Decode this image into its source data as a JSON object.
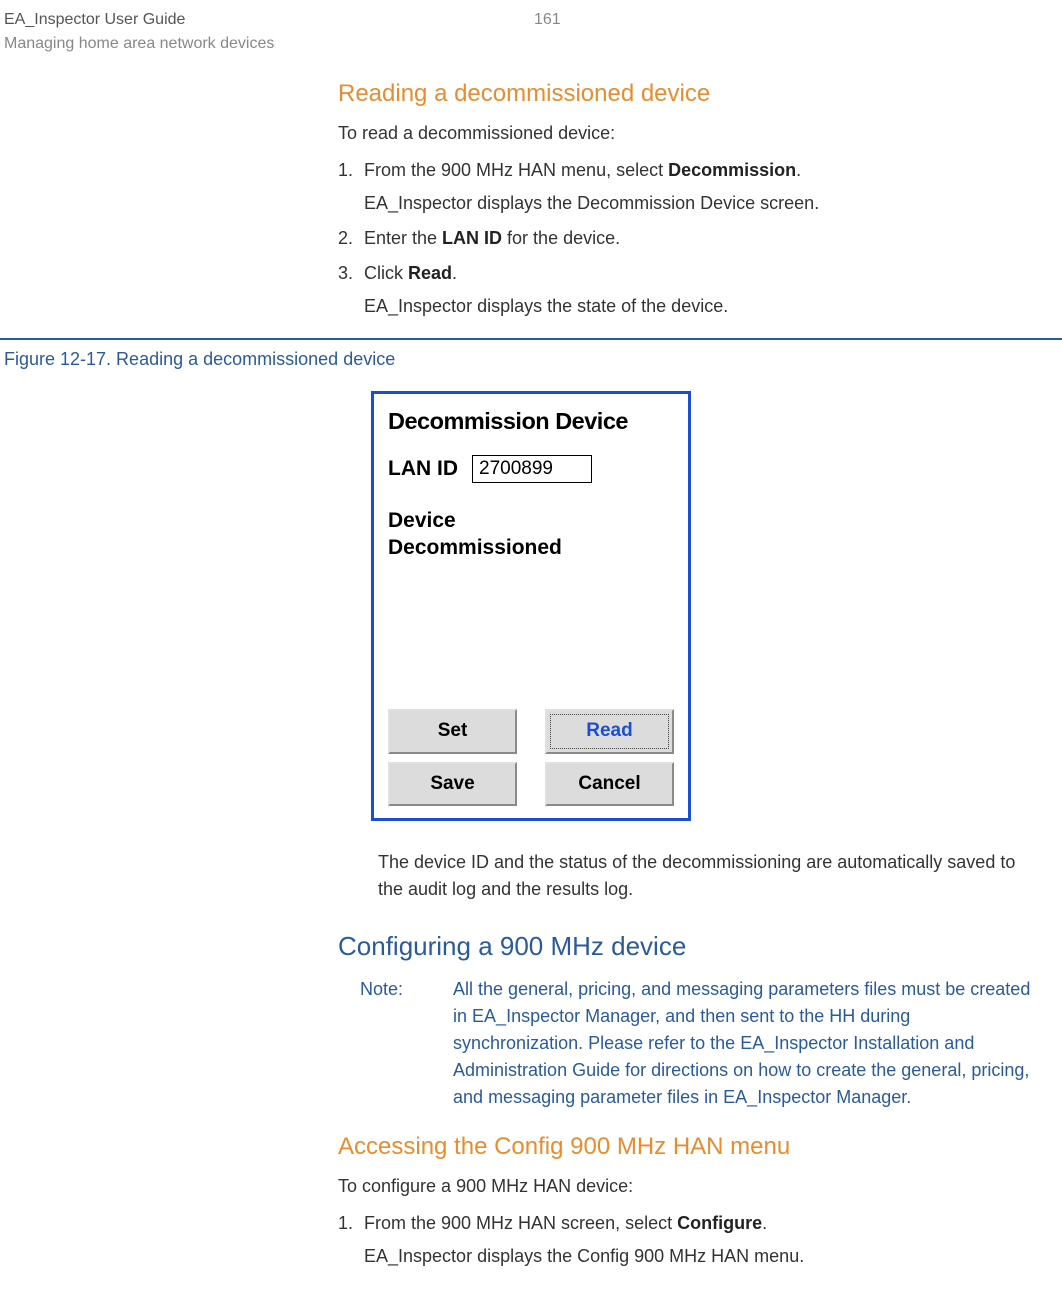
{
  "header": {
    "doc_title": "EA_Inspector User Guide",
    "doc_section": "Managing home area network devices",
    "page_number": "161"
  },
  "section1": {
    "heading": "Reading a decommissioned device",
    "intro": "To read a decommissioned device:",
    "steps": [
      {
        "text_before": "From the 900 MHz HAN menu, select ",
        "bold": "Decommission",
        "text_after": ".",
        "sub": "EA_Inspector displays the Decommission Device screen."
      },
      {
        "text_before": "Enter the ",
        "bold": "LAN ID",
        "text_after": " for the device.",
        "sub": ""
      },
      {
        "text_before": "Click ",
        "bold": "Read",
        "text_after": ".",
        "sub": "EA_Inspector displays the state of the device."
      }
    ]
  },
  "figure": {
    "caption": "Figure 12-17. Reading a decommissioned device",
    "screen": {
      "title": "Decommission Device",
      "lan_label": "LAN ID",
      "lan_value": "2700899",
      "status_line1": "Device",
      "status_line2": "Decommissioned",
      "buttons": {
        "set": "Set",
        "read": "Read",
        "save": "Save",
        "cancel": "Cancel"
      }
    },
    "after_text": "The device ID and the status of the decommissioning are automatically saved to the audit log and the results log."
  },
  "section2": {
    "heading": "Configuring a 900 MHz device",
    "note_label": "Note:",
    "note_pre": "All the general, pricing, and messaging parameters files must be created in EA_Inspector Manager, and then sent to the HH during synchronization. Please refer to the ",
    "note_guide": "EA_Inspector Installation and Administration Guide",
    "note_post": " for directions on how to create the general, pricing, and messaging parameter files in EA_Inspector Manager."
  },
  "section3": {
    "heading": "Accessing the Config 900 MHz HAN menu",
    "intro": "To configure a 900 MHz HAN device:",
    "steps": [
      {
        "text_before": "From the 900 MHz HAN screen, select ",
        "bold": "Configure",
        "text_after": ".",
        "sub": "EA_Inspector displays the Config 900 MHz HAN menu."
      }
    ]
  }
}
